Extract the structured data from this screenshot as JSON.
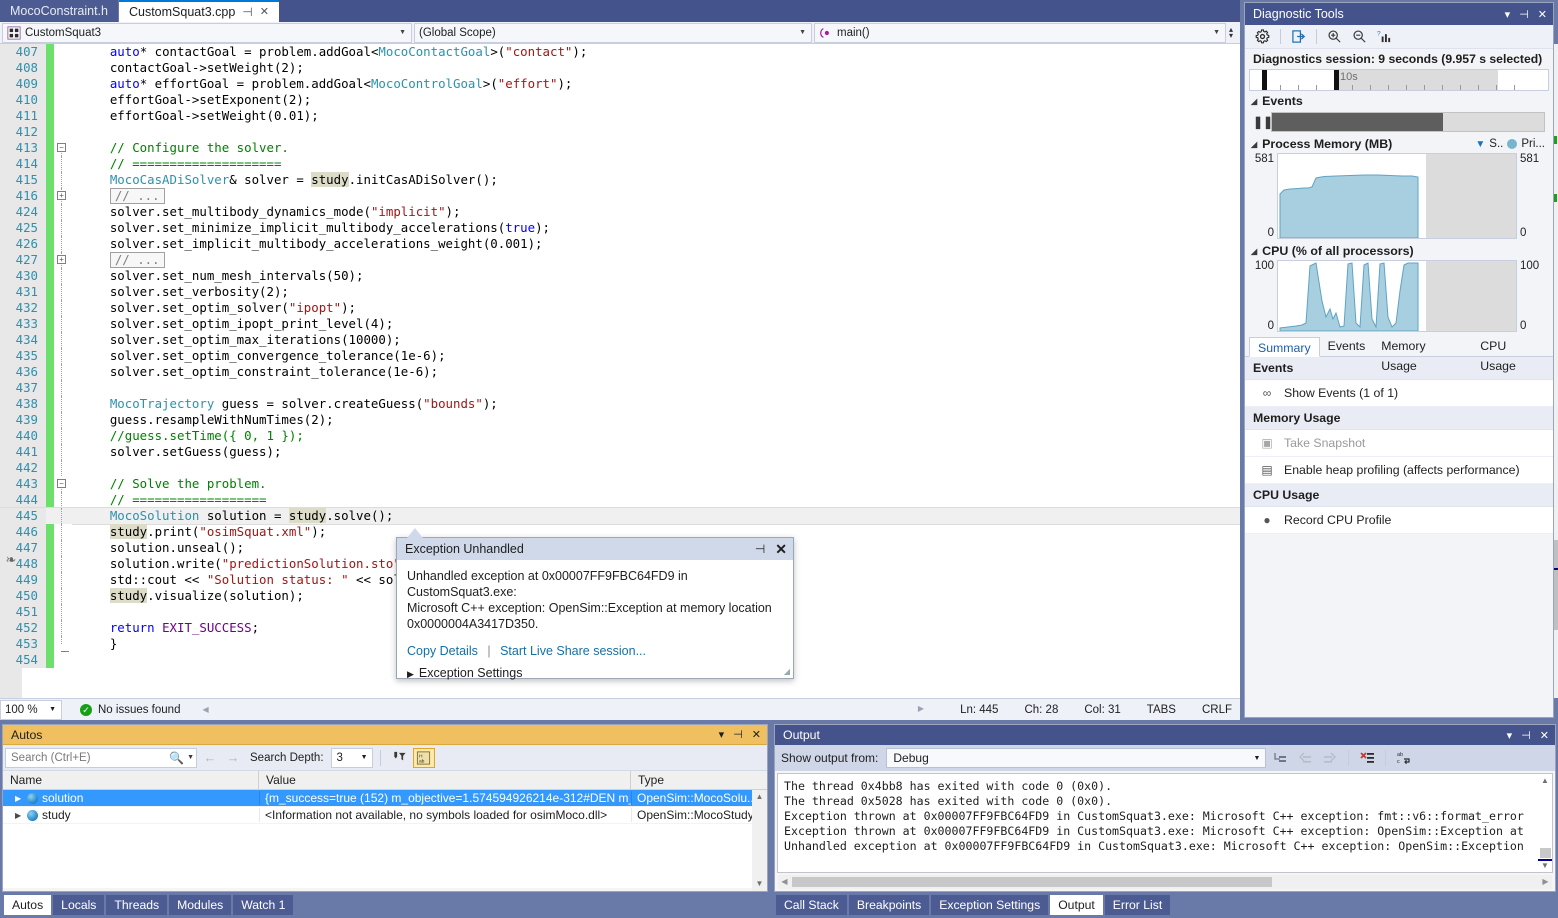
{
  "tabs": [
    {
      "label": "MocoConstraint.h",
      "active": false
    },
    {
      "label": "CustomSquat3.cpp",
      "active": true
    }
  ],
  "navbar": {
    "project": "CustomSquat3",
    "scope": "(Global Scope)",
    "member": "main()"
  },
  "editor": {
    "lines": [
      {
        "num": "407",
        "changed": true,
        "html": "<span class=\"k\">auto</span>* contactGoal = problem.addGoal&lt;<span class=\"t\">MocoContactGoal</span>&gt;(<span class=\"s\">\"contact\"</span>);"
      },
      {
        "num": "408",
        "changed": true,
        "html": "contactGoal-&gt;setWeight(2);"
      },
      {
        "num": "409",
        "changed": true,
        "html": "<span class=\"k\">auto</span>* effortGoal = problem.addGoal&lt;<span class=\"t\">MocoControlGoal</span>&gt;(<span class=\"s\">\"effort\"</span>);"
      },
      {
        "num": "410",
        "changed": true,
        "html": "effortGoal-&gt;setExponent(2);"
      },
      {
        "num": "411",
        "changed": true,
        "html": "effortGoal-&gt;setWeight(0.01);"
      },
      {
        "num": "412",
        "changed": true,
        "html": ""
      },
      {
        "num": "413",
        "changed": true,
        "outline": "minus",
        "html": "<span class=\"c\">// Configure the solver.</span>"
      },
      {
        "num": "414",
        "changed": true,
        "outline": "line",
        "html": "<span class=\"c\">// ====================</span>"
      },
      {
        "num": "415",
        "changed": true,
        "outline": "line",
        "html": "<span class=\"t\">MocoCasADiSolver</span>&amp; solver = <span class=\"hlw\">study</span>.initCasADiSolver();"
      },
      {
        "num": "416",
        "changed": true,
        "outline": "plus",
        "html": "<span class=\"collapsed\">// ...</span>"
      },
      {
        "num": "424",
        "changed": true,
        "outline": "line",
        "html": "solver.set_multibody_dynamics_mode(<span class=\"s\">\"implicit\"</span>);"
      },
      {
        "num": "425",
        "changed": true,
        "outline": "line",
        "html": "solver.set_minimize_implicit_multibody_accelerations(<span class=\"k\">true</span>);"
      },
      {
        "num": "426",
        "changed": true,
        "outline": "line",
        "html": "solver.set_implicit_multibody_accelerations_weight(0.001);"
      },
      {
        "num": "427",
        "changed": true,
        "outline": "plus",
        "html": "<span class=\"collapsed\">// ...</span>"
      },
      {
        "num": "430",
        "changed": true,
        "outline": "line",
        "html": "solver.set_num_mesh_intervals(50);"
      },
      {
        "num": "431",
        "changed": true,
        "outline": "line",
        "html": "solver.set_verbosity(2);"
      },
      {
        "num": "432",
        "changed": true,
        "outline": "line",
        "html": "solver.set_optim_solver(<span class=\"s\">\"ipopt\"</span>);"
      },
      {
        "num": "433",
        "changed": true,
        "outline": "line",
        "html": "solver.set_optim_ipopt_print_level(4);"
      },
      {
        "num": "434",
        "changed": true,
        "outline": "line",
        "html": "solver.set_optim_max_iterations(10000);"
      },
      {
        "num": "435",
        "changed": true,
        "outline": "line",
        "html": "solver.set_optim_convergence_tolerance(1e-6);"
      },
      {
        "num": "436",
        "changed": true,
        "outline": "line",
        "html": "solver.set_optim_constraint_tolerance(1e-6);"
      },
      {
        "num": "437",
        "changed": true,
        "outline": "line",
        "html": ""
      },
      {
        "num": "438",
        "changed": true,
        "outline": "line",
        "html": "<span class=\"t\">MocoTrajectory</span> guess = solver.createGuess(<span class=\"s\">\"bounds\"</span>);"
      },
      {
        "num": "439",
        "changed": true,
        "outline": "line",
        "html": "guess.resampleWithNumTimes(2);"
      },
      {
        "num": "440",
        "changed": true,
        "outline": "line",
        "html": "<span class=\"c\">//guess.setTime({ 0, 1 });</span>"
      },
      {
        "num": "441",
        "changed": true,
        "outline": "line",
        "html": "solver.setGuess(guess);"
      },
      {
        "num": "442",
        "changed": true,
        "outline": "line",
        "html": ""
      },
      {
        "num": "443",
        "changed": true,
        "outline": "minus",
        "html": "<span class=\"c\">// Solve the problem.</span>"
      },
      {
        "num": "444",
        "changed": true,
        "outline": "line",
        "html": "<span class=\"c\">// ==================</span>"
      },
      {
        "num": "445",
        "changed": true,
        "outline": "line",
        "current": true,
        "html": "<span class=\"t\">MocoSolution</span> solution = <span class=\"hlw\">study</span>.solve();"
      },
      {
        "num": "446",
        "changed": true,
        "outline": "line",
        "html": "<span class=\"hlw\">study</span>.print(<span class=\"s\">\"osimSquat.xml\"</span>);"
      },
      {
        "num": "447",
        "changed": true,
        "outline": "line",
        "html": "solution.unseal();"
      },
      {
        "num": "448",
        "changed": true,
        "outline": "line",
        "html": "solution.write(<span class=\"s\">\"predictionSolution.sto\"</span>);"
      },
      {
        "num": "449",
        "changed": true,
        "outline": "line",
        "html": "std::cout &lt;&lt; <span class=\"s\">\"Solution status: \"</span> &lt;&lt; sol"
      },
      {
        "num": "450",
        "changed": true,
        "outline": "line",
        "html": "<span class=\"hlw\">study</span>.visualize(solution);"
      },
      {
        "num": "451",
        "changed": true,
        "outline": "line",
        "html": ""
      },
      {
        "num": "452",
        "changed": true,
        "outline": "line",
        "html": "<span class=\"k\">return</span> <span class=\"m\">EXIT_SUCCESS</span>;"
      },
      {
        "num": "453",
        "changed": true,
        "outline": "end",
        "html": "}"
      },
      {
        "num": "454",
        "changed": true,
        "html": ""
      }
    ]
  },
  "exception_popup": {
    "title": "Exception Unhandled",
    "message_line1": "Unhandled exception at 0x00007FF9FBC64FD9 in CustomSquat3.exe:",
    "message_line2": "Microsoft C++ exception: OpenSim::Exception at memory location",
    "message_line3": "0x0000004A3417D350.",
    "copy_details": "Copy Details",
    "live_share": "Start Live Share session...",
    "settings": "Exception Settings",
    "pin_icon": "pin-icon",
    "close_icon": "close-icon"
  },
  "editor_status": {
    "zoom": "100 %",
    "issues": "No issues found",
    "line": "Ln: 445",
    "char": "Ch: 28",
    "col": "Col: 31",
    "tabs": "TABS",
    "eol": "CRLF"
  },
  "diagnostics": {
    "title": "Diagnostic Tools",
    "session": "Diagnostics session: 9 seconds (9.957 s selected)",
    "ruler_label": "10s",
    "sections": {
      "events": "Events",
      "memory": "Process Memory (MB)",
      "cpu": "CPU (% of all processors)"
    },
    "legend": {
      "snapshot": "S..",
      "private": "Pri..."
    },
    "memory_axis": {
      "max": "581",
      "min": "0"
    },
    "cpu_axis": {
      "max": "100",
      "min": "0"
    },
    "tabs": [
      {
        "label": "Summary",
        "active": true
      },
      {
        "label": "Events",
        "active": false
      },
      {
        "label": "Memory Usage",
        "active": false
      },
      {
        "label": "CPU Usage",
        "active": false
      }
    ],
    "summary": [
      {
        "kind": "header",
        "label": "Events"
      },
      {
        "kind": "item",
        "label": "Show Events (1 of 1)",
        "icon": "events-icon",
        "disabled": false
      },
      {
        "kind": "header",
        "label": "Memory Usage"
      },
      {
        "kind": "item",
        "label": "Take Snapshot",
        "icon": "camera-icon",
        "disabled": true
      },
      {
        "kind": "item",
        "label": "Enable heap profiling (affects performance)",
        "icon": "heap-icon",
        "disabled": false
      },
      {
        "kind": "header",
        "label": "CPU Usage"
      },
      {
        "kind": "item",
        "label": "Record CPU Profile",
        "icon": "record-icon",
        "disabled": false
      }
    ],
    "colors": {
      "graph_fill": "#a8cfe0",
      "graph_stroke": "#5fa3c4",
      "inactive": "#dcdcdc"
    }
  },
  "chart_data": [
    {
      "type": "area",
      "title": "Process Memory (MB)",
      "ylabel": "MB",
      "ylim": [
        0,
        581
      ],
      "yticks": [
        "0",
        "581"
      ],
      "xlim": [
        0,
        16
      ],
      "x": [
        0,
        0.3,
        0.7,
        1.2,
        2.0,
        2.6,
        3.0,
        3.4,
        4.0,
        5.0,
        6.0,
        7.0,
        8.0,
        9.0,
        9.9
      ],
      "values": [
        0,
        300,
        330,
        345,
        350,
        352,
        400,
        462,
        470,
        470,
        472,
        473,
        474,
        472,
        470
      ],
      "note": "recorded portion spans 0 to 9.957s; remaining timeline greyed out"
    },
    {
      "type": "area",
      "title": "CPU (% of all processors)",
      "ylabel": "%",
      "ylim": [
        0,
        100
      ],
      "yticks": [
        "0",
        "100"
      ],
      "xlim": [
        0,
        16
      ],
      "x": [
        0,
        0.5,
        1.0,
        1.5,
        2.0,
        2.4,
        2.8,
        3.2,
        3.6,
        4.0,
        4.4,
        4.8,
        5.2,
        5.6,
        6.0,
        6.4,
        6.8,
        7.2,
        7.6,
        8.0,
        8.4,
        8.8,
        9.2,
        9.6,
        9.9
      ],
      "values": [
        3,
        4,
        5,
        6,
        8,
        95,
        100,
        40,
        12,
        22,
        10,
        100,
        100,
        15,
        100,
        100,
        20,
        100,
        100,
        12,
        30,
        100,
        100,
        100,
        100
      ],
      "note": "spiky CPU trace with several bursts reaching 100%"
    }
  ],
  "autos": {
    "title": "Autos",
    "search_placeholder": "Search (Ctrl+E)",
    "search_depth_label": "Search Depth:",
    "search_depth_value": "3",
    "columns": [
      "Name",
      "Value",
      "Type"
    ],
    "rows": [
      {
        "name": "solution",
        "value": "{m_success=true (152) m_objective=1.574594926214e-312#DEN m_...",
        "type": "OpenSim::MocoSolu...",
        "selected": true
      },
      {
        "name": "study",
        "value": "<Information not available, no symbols loaded for osimMoco.dll>",
        "type": "OpenSim::MocoStudy",
        "selected": false
      }
    ]
  },
  "output": {
    "title": "Output",
    "show_output_from_label": "Show output from:",
    "source": "Debug",
    "lines": [
      "The thread 0x4bb8 has exited with code 0 (0x0).",
      "The thread 0x5028 has exited with code 0 (0x0).",
      "Exception thrown at 0x00007FF9FBC64FD9 in CustomSquat3.exe: Microsoft C++ exception: fmt::v6::format_error",
      "Exception thrown at 0x00007FF9FBC64FD9 in CustomSquat3.exe: Microsoft C++ exception: OpenSim::Exception at",
      "Unhandled exception at 0x00007FF9FBC64FD9 in CustomSquat3.exe: Microsoft C++ exception: OpenSim::Exception"
    ]
  },
  "bottom_tabs_left": [
    {
      "label": "Autos",
      "active": true
    },
    {
      "label": "Locals",
      "active": false
    },
    {
      "label": "Threads",
      "active": false
    },
    {
      "label": "Modules",
      "active": false
    },
    {
      "label": "Watch 1",
      "active": false
    }
  ],
  "bottom_tabs_right": [
    {
      "label": "Call Stack",
      "active": false
    },
    {
      "label": "Breakpoints",
      "active": false
    },
    {
      "label": "Exception Settings",
      "active": false
    },
    {
      "label": "Output",
      "active": true
    },
    {
      "label": "Error List",
      "active": false
    }
  ]
}
